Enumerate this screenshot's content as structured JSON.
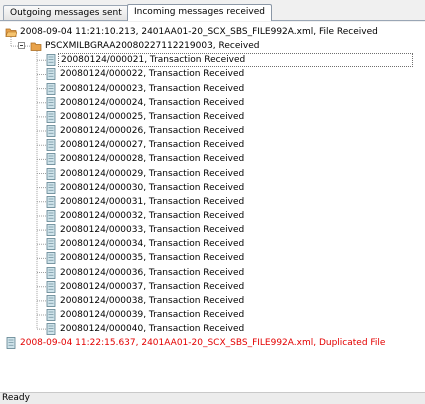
{
  "tabs": [
    {
      "label": "Outgoing messages sent",
      "active": false
    },
    {
      "label": "Incoming messages received",
      "active": true
    }
  ],
  "tree": {
    "root": {
      "label": "2008-09-04 11:21:10.213, 2401AA01-20_SCX_SBS_FILE992A.xml, File Received",
      "icon": "folder-open-icon"
    },
    "batch": {
      "label": "PSCXMILBGRAA20080227112219003, Received",
      "icon": "folder-icon"
    },
    "transactions": [
      "20080124/000021, Transaction Received",
      "20080124/000022, Transaction Received",
      "20080124/000023, Transaction Received",
      "20080124/000024, Transaction Received",
      "20080124/000025, Transaction Received",
      "20080124/000026, Transaction Received",
      "20080124/000027, Transaction Received",
      "20080124/000028, Transaction Received",
      "20080124/000029, Transaction Received",
      "20080124/000030, Transaction Received",
      "20080124/000031, Transaction Received",
      "20080124/000032, Transaction Received",
      "20080124/000033, Transaction Received",
      "20080124/000034, Transaction Received",
      "20080124/000035, Transaction Received",
      "20080124/000036, Transaction Received",
      "20080124/000037, Transaction Received",
      "20080124/000038, Transaction Received",
      "20080124/000039, Transaction Received",
      "20080124/000040, Transaction Received"
    ],
    "duplicate": {
      "label": "2008-09-04 11:22:15.637, 2401AA01-20_SCX_SBS_FILE992A.xml, Duplicated File",
      "icon": "document-icon",
      "color": "#e30000"
    }
  },
  "colors": {
    "tree_lines": "#a0a0a0",
    "folder": "#e8a24a",
    "document": "#cfe3ea",
    "error_text": "#e30000"
  },
  "status": "Ready"
}
